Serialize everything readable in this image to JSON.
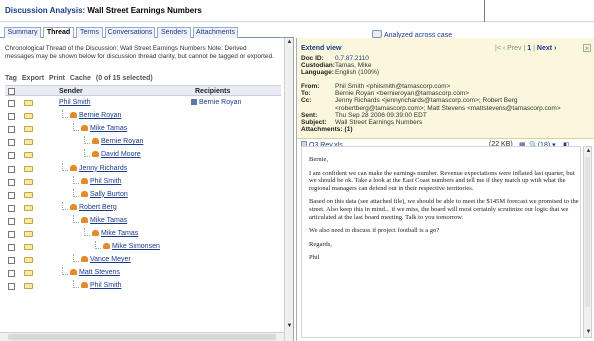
{
  "header": {
    "label": "Discussion Analysis:",
    "title": "Wall Street Earnings Numbers"
  },
  "tabs": [
    {
      "label": "Summary",
      "active": false
    },
    {
      "label": "Thread",
      "active": true
    },
    {
      "label": "Terms",
      "active": false
    },
    {
      "label": "Conversations",
      "active": false
    },
    {
      "label": "Senders",
      "active": false
    },
    {
      "label": "Attachments",
      "active": false
    }
  ],
  "analyzed_link": "Analyzed across case",
  "left": {
    "description": "Chronological Thread of the Discussion: Wall Street Earnings Numbers Note: Derived messages may be shown below for discussion thread clarity, but cannot be tagged or exported.",
    "toolbar": {
      "tag": "Tag",
      "export": "Export",
      "print": "Print",
      "cache": "Cache",
      "selection": "(0 of 15 selected)"
    },
    "columns": {
      "sender": "Sender",
      "recipients": "Recipients"
    },
    "rows": [
      {
        "sender": "Phil Smith",
        "recipient": "Bernie Royan",
        "indent": 0
      },
      {
        "sender": "Bernie Royan",
        "recipient": "",
        "indent": 1
      },
      {
        "sender": "Mike Tamas",
        "recipient": "",
        "indent": 2
      },
      {
        "sender": "Bernie Royan",
        "recipient": "",
        "indent": 3
      },
      {
        "sender": "David Moore",
        "recipient": "",
        "indent": 3
      },
      {
        "sender": "Jenny Richards",
        "recipient": "",
        "indent": 1
      },
      {
        "sender": "Phil Smith",
        "recipient": "",
        "indent": 2
      },
      {
        "sender": "Sally Burton",
        "recipient": "",
        "indent": 2
      },
      {
        "sender": "Robert Berg",
        "recipient": "",
        "indent": 1
      },
      {
        "sender": "Mike Tamas",
        "recipient": "",
        "indent": 2
      },
      {
        "sender": "Mike Tamas",
        "recipient": "",
        "indent": 3
      },
      {
        "sender": "Mike Simonsen",
        "recipient": "",
        "indent": 4
      },
      {
        "sender": "Vance Meyer",
        "recipient": "",
        "indent": 2
      },
      {
        "sender": "Matt Stevens",
        "recipient": "",
        "indent": 1
      },
      {
        "sender": "Phil Smith",
        "recipient": "",
        "indent": 2
      }
    ]
  },
  "right": {
    "extend_view": "Extend view",
    "nav": {
      "prev": "Prev",
      "page": "1",
      "next": "Next"
    },
    "doc_id": {
      "k": "Doc ID:",
      "v": "0.7.87.2110"
    },
    "custodian": {
      "k": "Custodian:",
      "v": "Tamas, Mike"
    },
    "language": {
      "k": "Language:",
      "v": "English (100%)"
    },
    "from": {
      "k": "From:",
      "v": "Phil Smith <philsmith@tamascorp.com>"
    },
    "to": {
      "k": "To:",
      "v": "Bernie Royan <bernieroyan@tamascorp.com>"
    },
    "cc": {
      "k": "Cc:",
      "v": "Jenny Richards <jennyrichards@tamascorp.com>; Robert Berg <robertberg@tamascorp.com>; Matt Stevens <mattstevens@tamascorp.com>"
    },
    "sent": {
      "k": "Sent:",
      "v": "Thu Sep 28 2006 09:39:00 EDT"
    },
    "subject": {
      "k": "Subject:",
      "v": "Wall Street Earnings Numbers"
    },
    "attachments": {
      "k": "Attachments:",
      "v": "(1)"
    },
    "attachment": {
      "name": "Q3 Rev.xls",
      "size": "(22 KB)",
      "hits": "(18)"
    },
    "body": [
      "Bernie,",
      "I am confident we can make the earnings number. Revenue expectations were inflated last quarter, but we should be ok. Take a look at the East Coast numbers and tell me if they match up with what the regional managers can defend out in their respective territories.",
      "Based on this data (see attached file), we should be able to meet the $145M forecast we promised to the street. Also keep this in mind... if we miss, the board will most certainly scrutinize our logic that we articulated at the last board meeting. Talk to you tomorrow.",
      "We also need to discuss if project football is a go?",
      "Regards,",
      "Phil"
    ]
  }
}
